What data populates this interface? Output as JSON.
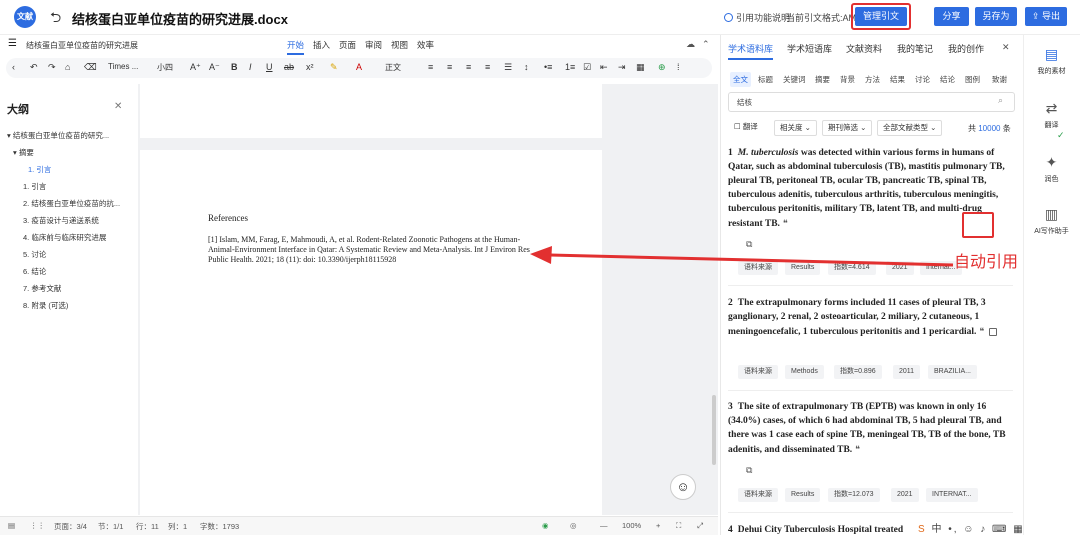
{
  "header": {
    "logo_text": "文献",
    "back_icon": "undo-arrow-icon",
    "title": "结核蛋白亚单位疫苗的研究进展.docx",
    "cite_help": "引用功能说明",
    "cite_format": "当前引文格式:AMA",
    "manage_cite": "管理引文",
    "share": "分享",
    "save_as": "另存为",
    "export": "导出"
  },
  "menubar": {
    "doc_name": "结核蛋白亚单位疫苗的研究进展",
    "tabs": [
      "开始",
      "插入",
      "页面",
      "审阅",
      "视图",
      "效率"
    ]
  },
  "toolbar": {
    "font_family": "Times ...",
    "font_size": "小四",
    "style": "正文"
  },
  "outline": {
    "heading": "大纲",
    "items": [
      {
        "label": "结核蛋白亚单位疫苗的研究..."
      },
      {
        "label": "摘要"
      },
      {
        "label": "1. 引言"
      },
      {
        "label": "1. 引言"
      },
      {
        "label": "2. 结核蛋白亚单位疫苗的抗..."
      },
      {
        "label": "3. 疫苗设计与递送系统"
      },
      {
        "label": "4. 临床前与临床研究进展"
      },
      {
        "label": "5. 讨论"
      },
      {
        "label": "6. 结论"
      },
      {
        "label": "7. 参考文献"
      },
      {
        "label": "8. 附录 (可选)"
      }
    ]
  },
  "document": {
    "references_heading": "References",
    "reference_1": "[1] Islam, MM, Farag, E, Mahmoudi, A, et al. Rodent-Related Zoonotic Pathogens at the Human-Animal-Environment Interface in Qatar: A Systematic Review and Meta-Analysis. Int J Environ Res Public Health. 2021; 18 (11): doi: 10.3390/ijerph18115928"
  },
  "statusbar": {
    "page": "页面：3/4",
    "section": "节：1/1",
    "row": "行：11",
    "col": "列：1",
    "words": "字数：1793",
    "zoom": "100%"
  },
  "right_panel": {
    "tabs": [
      "学术语料库",
      "学术短语库",
      "文献资料",
      "我的笔记",
      "我的创作"
    ],
    "chips": [
      "全文",
      "标题",
      "关键词",
      "摘要",
      "背景",
      "方法",
      "结果",
      "讨论",
      "结论",
      "图例",
      "致谢"
    ],
    "search_value": "结核",
    "filters": [
      "翻译",
      "相关度",
      "期刊筛选",
      "全部文献类型"
    ],
    "total_prefix": "共",
    "total_count": "10000",
    "total_suffix": "条",
    "results": [
      {
        "num": "1",
        "lead_italic": "M. tuberculosis",
        "text": " was detected within various forms in humans of Qatar, such as abdominal tuberculosis (TB), mastitis pulmonary TB, pleural TB, peritoneal TB, ocular TB, pancreatic TB, spinal TB, tuberculous adenitis, tuberculous arthritis, tuberculous meningitis, tuberculous peritonitis, military TB, latent TB, and multi-drug resistant TB.",
        "tags": [
          "语料来源",
          "Results",
          "指数=4.614",
          "2021",
          "Internat..."
        ]
      },
      {
        "num": "2",
        "lead_italic": "",
        "text": "The extrapulmonary forms included 11 cases of pleural TB, 3 ganglionary, 2 renal, 2 osteoarticular, 2 miliary, 2 cutaneous, 1 meningoencefalic, 1 tuberculous peritonitis and 1 pericardial.",
        "tags": [
          "语料来源",
          "Methods",
          "指数=0.896",
          "2011",
          "BRAZILIA..."
        ]
      },
      {
        "num": "3",
        "lead_italic": "",
        "text": "The site of extrapulmonary TB (EPTB) was known in only 16 (34.0%) cases, of which 6 had abdominal TB, 5 had pleural TB, and there was 1 case each of spine TB, meningeal TB, TB of the bone, TB adenitis, and disseminated TB.",
        "tags": [
          "语料来源",
          "Results",
          "指数=12.073",
          "2021",
          "INTERNAT..."
        ]
      },
      {
        "num": "4",
        "lead_italic": "",
        "text": "Dehui City Tuberculosis Hospital treated",
        "tags": []
      }
    ]
  },
  "annotation": {
    "auto_cite": "自动引用"
  },
  "sidebar": {
    "items": [
      "我的素材",
      "翻译",
      "润色",
      "AI写作助手"
    ]
  },
  "colors": {
    "accent": "#2d6ce0",
    "highlight": "#e23030"
  }
}
